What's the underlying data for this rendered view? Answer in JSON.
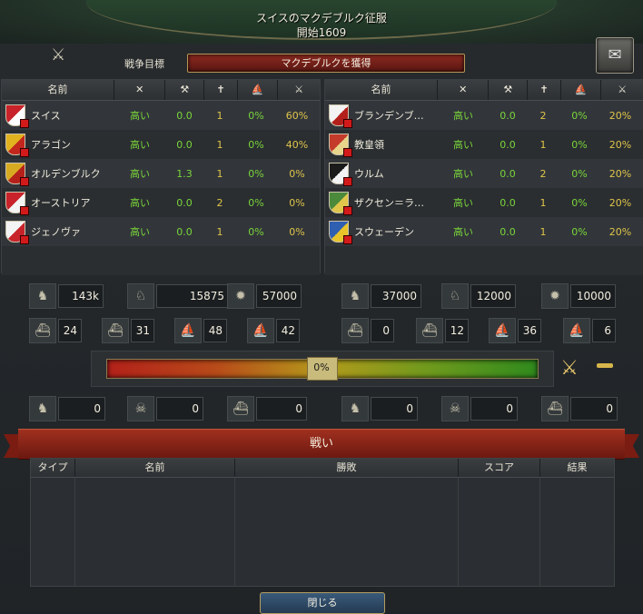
{
  "header": {
    "title": "スイスのマクデブルク征服",
    "subtitle": "開始1609"
  },
  "war_goal": {
    "label": "戦争目標",
    "value": "マクデブルクを獲得"
  },
  "columns": {
    "name": "名前"
  },
  "attackers": [
    {
      "name": "スイス",
      "c1": "高い",
      "c2": "0.0",
      "c3": "1",
      "c4": "0%",
      "c5": "60%",
      "colors": [
        "#c8232b",
        "#ffffff"
      ]
    },
    {
      "name": "アラゴン",
      "c1": "高い",
      "c2": "0.0",
      "c3": "1",
      "c4": "0%",
      "c5": "40%",
      "colors": [
        "#e1b21e",
        "#c2261c"
      ]
    },
    {
      "name": "オルデンブルク",
      "c1": "高い",
      "c2": "1.3",
      "c3": "1",
      "c4": "0%",
      "c5": "0%",
      "colors": [
        "#d8aa22",
        "#b5201b"
      ]
    },
    {
      "name": "オーストリア",
      "c1": "高い",
      "c2": "0.0",
      "c3": "2",
      "c4": "0%",
      "c5": "0%",
      "colors": [
        "#c8232b",
        "#f3f3f3"
      ]
    },
    {
      "name": "ジェノヴァ",
      "c1": "高い",
      "c2": "0.0",
      "c3": "1",
      "c4": "0%",
      "c5": "0%",
      "colors": [
        "#f3f3f3",
        "#c8232b"
      ]
    }
  ],
  "defenders": [
    {
      "name": "ブランデンブ…",
      "c1": "高い",
      "c2": "0.0",
      "c3": "2",
      "c4": "0%",
      "c5": "20%",
      "colors": [
        "#f3f3f3",
        "#b3201b"
      ]
    },
    {
      "name": "教皇領",
      "c1": "高い",
      "c2": "0.0",
      "c3": "1",
      "c4": "0%",
      "c5": "20%",
      "colors": [
        "#c43b2b",
        "#e8d48a"
      ]
    },
    {
      "name": "ウルム",
      "c1": "高い",
      "c2": "0.0",
      "c3": "2",
      "c4": "0%",
      "c5": "20%",
      "colors": [
        "#1b1b1b",
        "#f3f3f3"
      ]
    },
    {
      "name": "ザクセン＝ラ…",
      "c1": "高い",
      "c2": "0.0",
      "c3": "1",
      "c4": "0%",
      "c5": "20%",
      "colors": [
        "#4a8a3a",
        "#e0c64a"
      ]
    },
    {
      "name": "スウェーデン",
      "c1": "高い",
      "c2": "0.0",
      "c3": "1",
      "c4": "0%",
      "c5": "20%",
      "colors": [
        "#2f5fb0",
        "#e8c42a"
      ]
    }
  ],
  "attacker_stats": {
    "infantry": "143k",
    "cavalry": "15875",
    "artillery": "57000",
    "heavy_ships": "24",
    "light_ships": "31",
    "galleys": "48",
    "transports": "42"
  },
  "defender_stats": {
    "infantry": "37000",
    "cavalry": "12000",
    "artillery": "10000",
    "heavy_ships": "0",
    "light_ships": "12",
    "galleys": "36",
    "transports": "6"
  },
  "war_score": {
    "text": "0%",
    "value": 0
  },
  "attacker_losses": {
    "infantry": "0",
    "cavalry": "0",
    "ships": "0"
  },
  "defender_losses": {
    "infantry": "0",
    "cavalry": "0",
    "ships": "0"
  },
  "battles": {
    "title": "戦い",
    "headers": [
      "タイプ",
      "名前",
      "勝敗",
      "スコア",
      "結果"
    ]
  },
  "close_label": "閉じる"
}
